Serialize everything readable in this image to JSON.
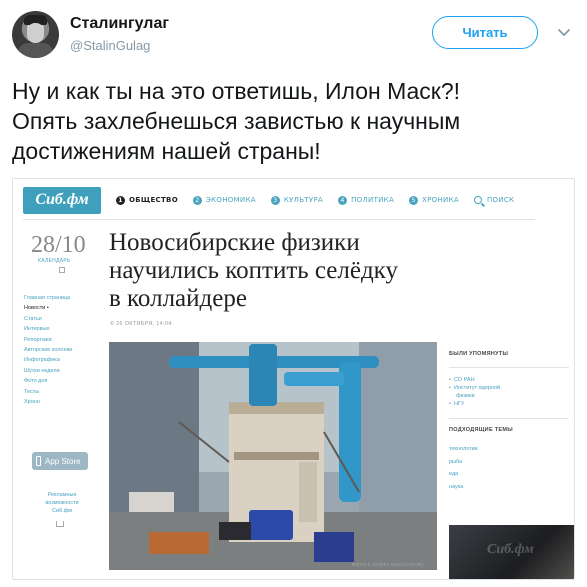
{
  "author": {
    "display_name": "Сталингулаг",
    "handle": "@StalinGulag"
  },
  "follow_label": "Читать",
  "tweet_lines": [
    "Ну и как ты на это ответишь, Илон Маск?!",
    "Опять захлебнешься завистью к научным",
    "достижениям нашей страны!"
  ],
  "screenshot": {
    "logo": "Сиб.фм",
    "nav": [
      {
        "num": "1",
        "label": "Общество",
        "active": true
      },
      {
        "num": "2",
        "label": "Экономика",
        "active": false
      },
      {
        "num": "3",
        "label": "Культура",
        "active": false
      },
      {
        "num": "4",
        "label": "Политика",
        "active": false
      },
      {
        "num": "5",
        "label": "Хроника",
        "active": false
      }
    ],
    "search_label": "Поиск",
    "date_big": "28/10",
    "calendar_label": "Календарь",
    "side_menu": [
      "Главная страница",
      "Новости •",
      "Статьи",
      "Интервью",
      "Репортажи",
      "Авторские колонки",
      "Инфографика",
      "Шутки недели",
      "Фото дня",
      "Тесты",
      "Хроно"
    ],
    "app_store_label": "App Store",
    "ads_lines": [
      "Рекламные",
      "возможности",
      "Сиб.фм"
    ],
    "headline_lines": [
      "Новосибирские физики",
      "научились коптить селёдку",
      "в коллайдере"
    ],
    "pub_date": "© 26 октября, 14:04",
    "photo_credit": "Фото с сайта kolcovo.ru",
    "mentioned_heading": "Были упомянуты",
    "mentioned": [
      "СО РАН",
      "Институт ядерной",
      "физики",
      "НГУ"
    ],
    "topics_heading": "Подходящие темы",
    "topics": [
      "технологии",
      "рыба",
      "еда",
      "наука"
    ],
    "thumb_watermark": "Сиб.фм"
  },
  "colors": {
    "accent": "#1da1f2",
    "site_link": "#4aa3c0",
    "logo_bg": "#3fa0bd"
  },
  "icons": {
    "caret": "chevron-down-icon",
    "search": "search-icon",
    "app_store": "phone-icon"
  }
}
